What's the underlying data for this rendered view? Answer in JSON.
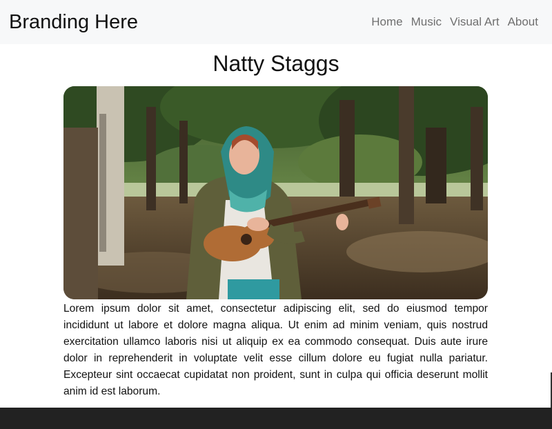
{
  "brand": "Branding Here",
  "nav": {
    "items": [
      {
        "label": "Home"
      },
      {
        "label": "Music"
      },
      {
        "label": "Visual Art"
      },
      {
        "label": "About"
      }
    ]
  },
  "page": {
    "title": "Natty Staggs",
    "body": "Lorem ipsum dolor sit amet, consectetur adipiscing elit, sed do eiusmod tempor incididunt ut labore et dolore magna aliqua. Ut enim ad minim veniam, quis nostrud exercitation ullamco laboris nisi ut aliquip ex ea commodo consequat. Duis aute irure dolor in reprehenderit in voluptate velit esse cillum dolore eu fugiat nulla pariatur. Excepteur sint occaecat cupidatat non proident, sunt in culpa qui officia deserunt mollit anim id est laborum."
  },
  "colors": {
    "navbar_bg": "#f7f8f9",
    "nav_link": "#6f6f6f",
    "footer_bg": "#222222"
  }
}
